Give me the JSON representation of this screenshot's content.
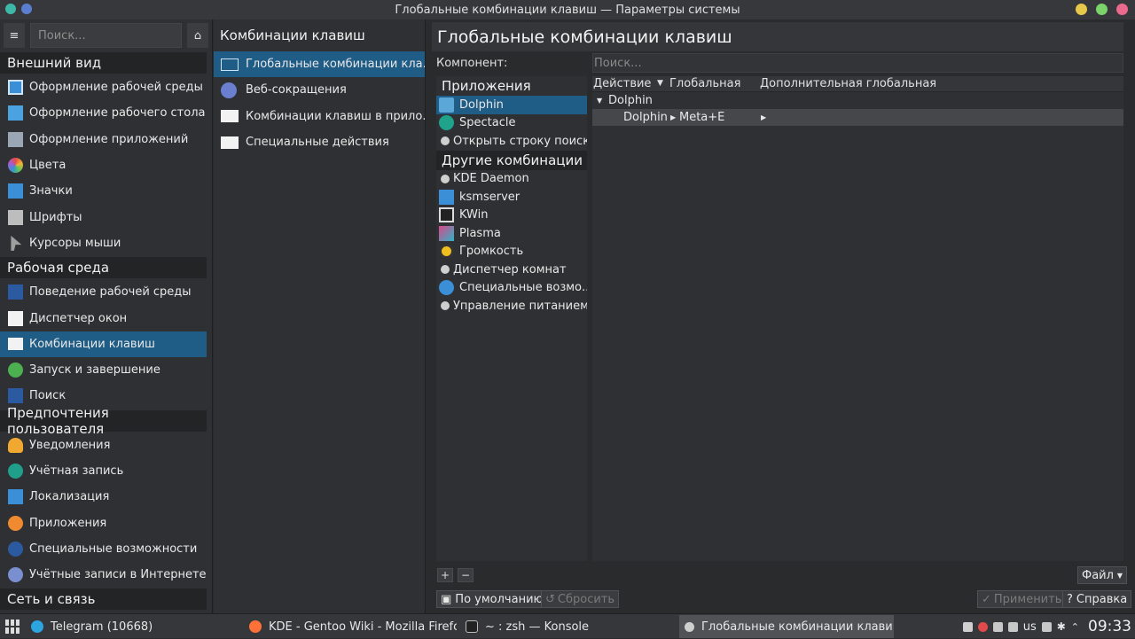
{
  "window": {
    "title": "Глобальные комбинации клавиш — Параметры системы"
  },
  "sidebar": {
    "search_placeholder": "Поиск...",
    "categories": [
      {
        "label": "Внешний вид",
        "items": [
          {
            "label": "Оформление рабочей среды",
            "icon": "workspace-theme-icon"
          },
          {
            "label": "Оформление рабочего стола",
            "icon": "desktop-theme-icon"
          },
          {
            "label": "Оформление приложений",
            "icon": "app-style-icon"
          },
          {
            "label": "Цвета",
            "icon": "colors-icon"
          },
          {
            "label": "Значки",
            "icon": "icons-icon"
          },
          {
            "label": "Шрифты",
            "icon": "fonts-icon"
          },
          {
            "label": "Курсоры мыши",
            "icon": "cursor-icon"
          }
        ]
      },
      {
        "label": "Рабочая среда",
        "items": [
          {
            "label": "Поведение рабочей среды",
            "icon": "workspace-behavior-icon"
          },
          {
            "label": "Диспетчер окон",
            "icon": "window-manager-icon"
          },
          {
            "label": "Комбинации клавиш",
            "icon": "keyboard-icon",
            "selected": true
          },
          {
            "label": "Запуск и завершение",
            "icon": "startup-icon"
          },
          {
            "label": "Поиск",
            "icon": "search-icon"
          }
        ]
      },
      {
        "label": "Предпочтения пользователя",
        "items": [
          {
            "label": "Уведомления",
            "icon": "bell-icon"
          },
          {
            "label": "Учётная запись",
            "icon": "user-icon"
          },
          {
            "label": "Локализация",
            "icon": "locale-icon"
          },
          {
            "label": "Приложения",
            "icon": "star-icon"
          },
          {
            "label": "Специальные возможности",
            "icon": "accessibility-icon"
          },
          {
            "label": "Учётные записи в Интернете",
            "icon": "online-accounts-icon"
          }
        ]
      },
      {
        "label": "Сеть и связь",
        "items": []
      }
    ]
  },
  "middle": {
    "title": "Комбинации клавиш",
    "items": [
      {
        "label": "Глобальные комбинации кла...",
        "selected": true
      },
      {
        "label": "Веб-сокращения"
      },
      {
        "label": "Комбинации клавиш в прило..."
      },
      {
        "label": "Специальные действия"
      }
    ]
  },
  "main": {
    "title": "Глобальные комбинации клавиш",
    "component_label": "Компонент:",
    "search_placeholder": "Поиск...",
    "apps_header": "Приложения",
    "apps": [
      {
        "label": "Dolphin",
        "selected": true
      },
      {
        "label": "Spectacle"
      },
      {
        "label": "Открыть строку поиск..."
      }
    ],
    "other_header": "Другие комбинации к",
    "others": [
      {
        "label": "KDE Daemon"
      },
      {
        "label": "ksmserver"
      },
      {
        "label": "KWin"
      },
      {
        "label": "Plasma"
      },
      {
        "label": "Громкость"
      },
      {
        "label": "Диспетчер комнат"
      },
      {
        "label": "Специальные возмо..."
      },
      {
        "label": "Управление питанием"
      }
    ],
    "columns": {
      "action": "Действие",
      "global": "Глобальная",
      "alt_global": "Дополнительная глобальная"
    },
    "tree": {
      "group": "Dolphin",
      "row": {
        "action": "Dolphin",
        "global": "Meta+E",
        "alt_global": ""
      }
    },
    "add_label": "+",
    "remove_label": "−",
    "file_label": "Файл",
    "defaults_label": "По умолчанию",
    "reset_label": "Сбросить",
    "apply_label": "Применить",
    "help_label": "Справка"
  },
  "taskbar": {
    "tasks": [
      {
        "label": "Telegram (10668)"
      },
      {
        "label": "KDE - Gentoo Wiki - Mozilla Firefox"
      },
      {
        "label": "~ : zsh — Konsole"
      },
      {
        "label": "Глобальные комбинации клави..."
      }
    ],
    "layout": "us",
    "clock": "09:33"
  }
}
